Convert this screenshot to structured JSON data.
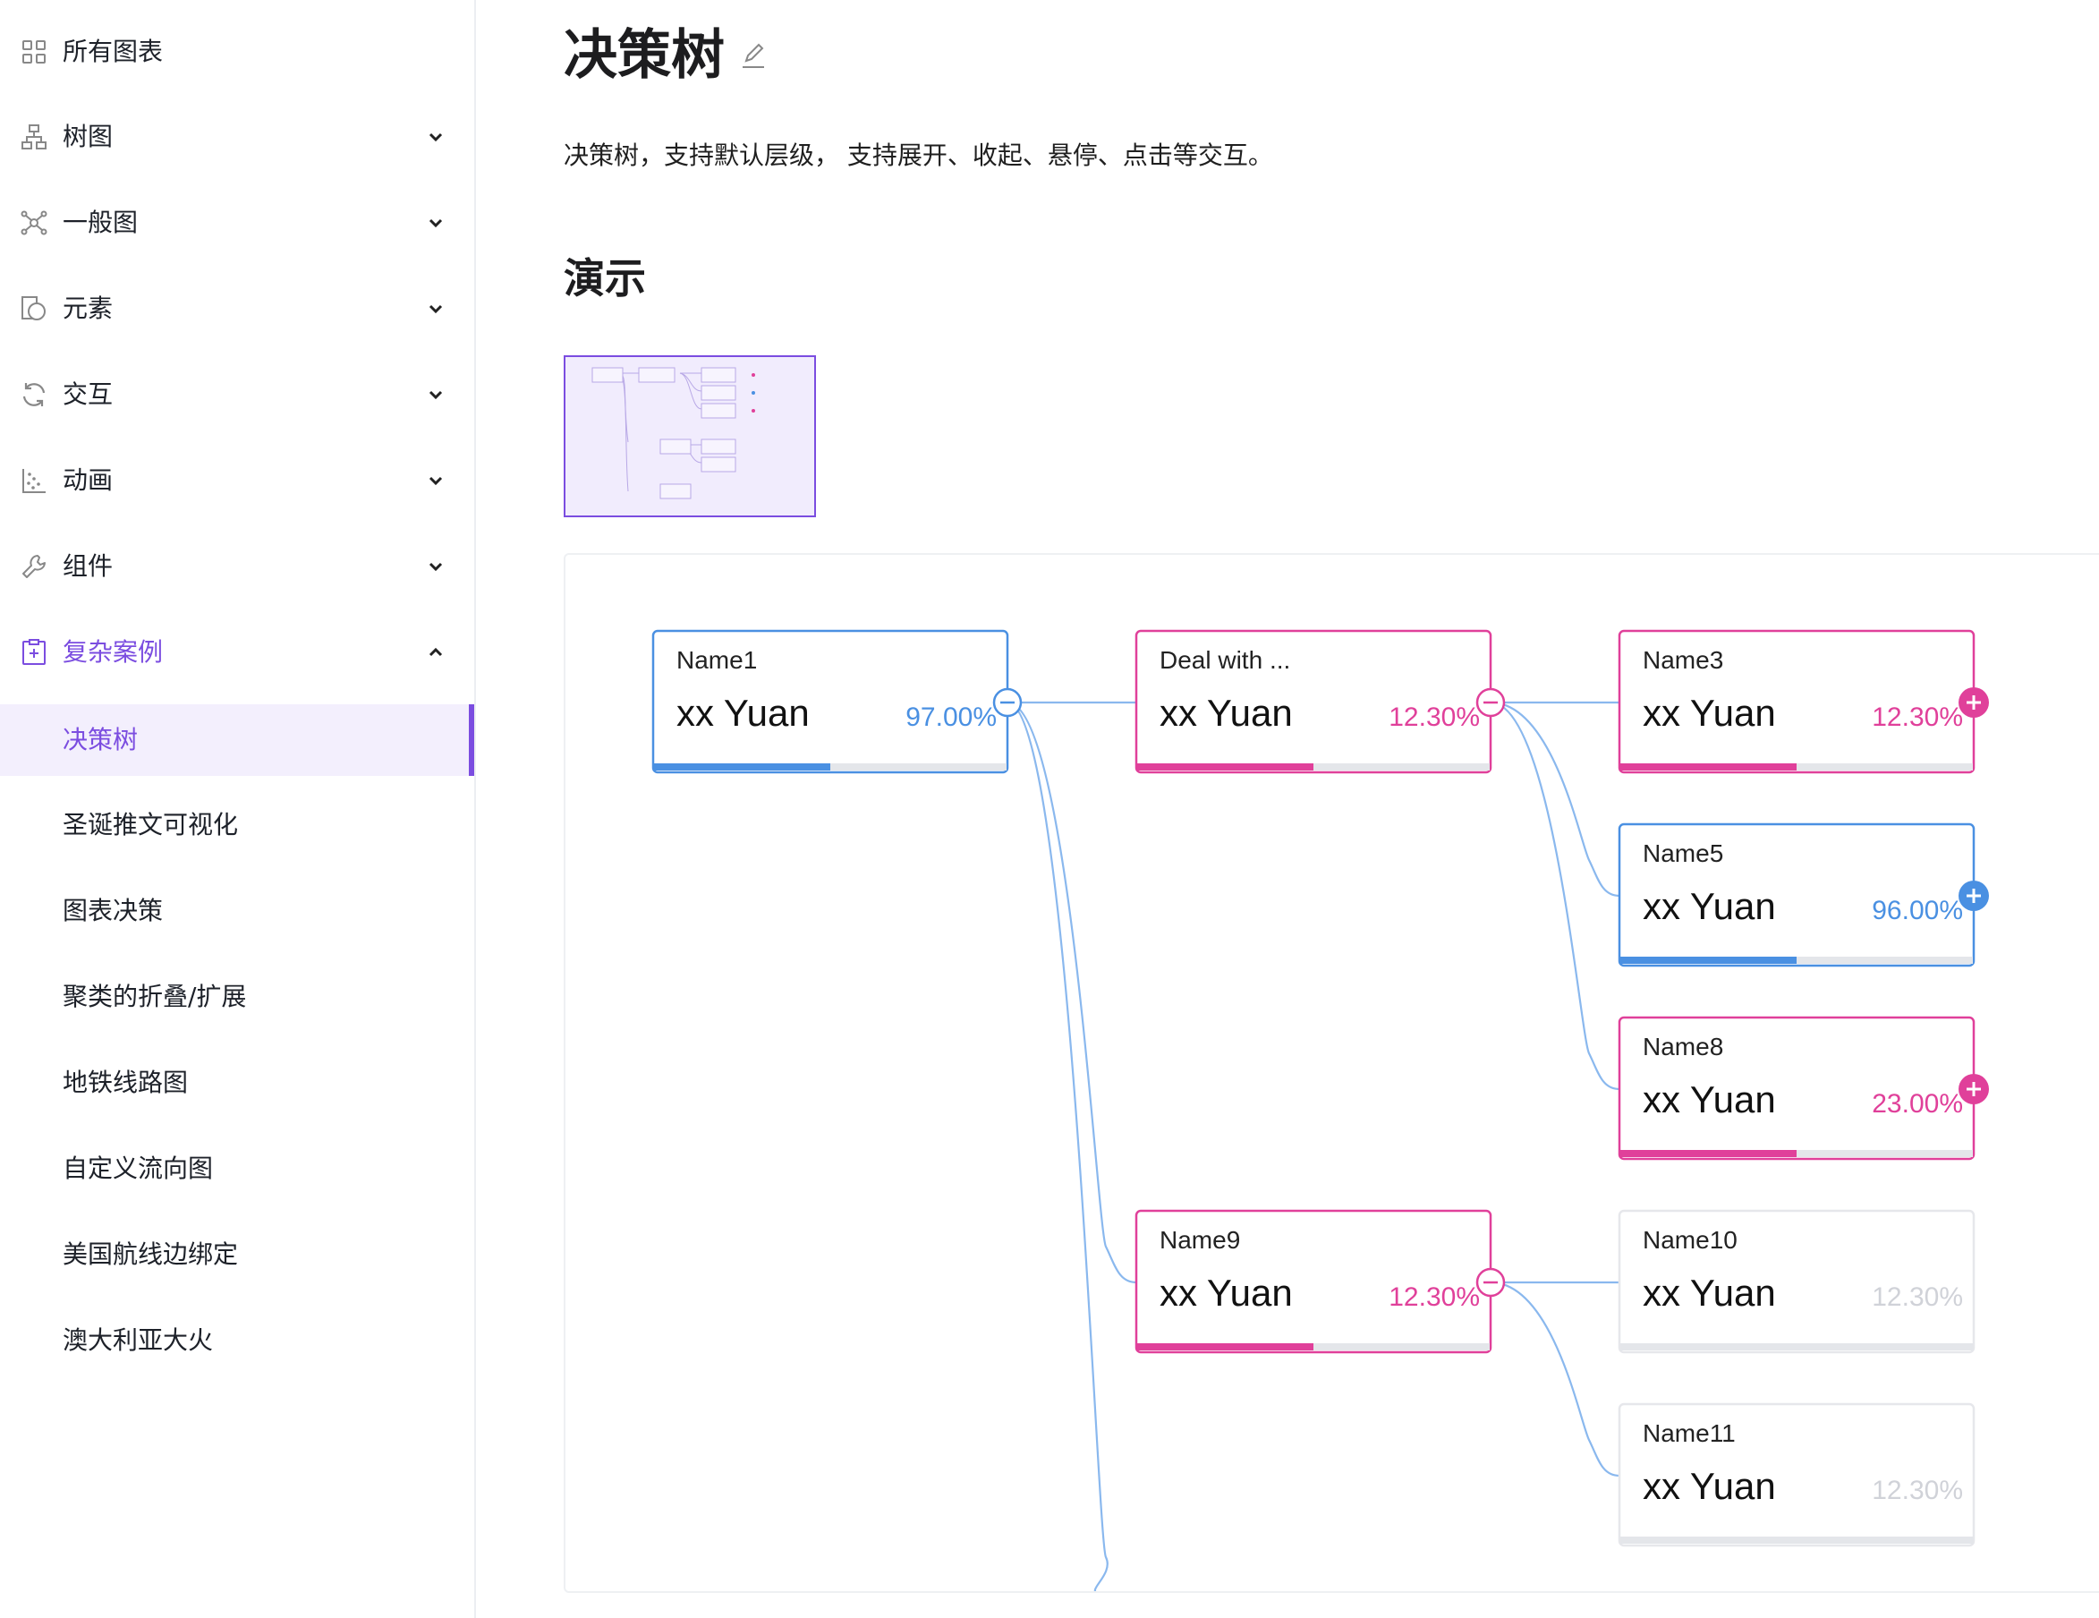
{
  "sidebar": {
    "items": [
      {
        "label": "所有图表",
        "icon": "grid-icon",
        "chevron": ""
      },
      {
        "label": "树图",
        "icon": "tree-icon",
        "chevron": "down"
      },
      {
        "label": "一般图",
        "icon": "graph-icon",
        "chevron": "down"
      },
      {
        "label": "元素",
        "icon": "shapes-icon",
        "chevron": "down"
      },
      {
        "label": "交互",
        "icon": "refresh-icon",
        "chevron": "down"
      },
      {
        "label": "动画",
        "icon": "scatter-icon",
        "chevron": "down"
      },
      {
        "label": "组件",
        "icon": "wrench-icon",
        "chevron": "down"
      },
      {
        "label": "复杂案例",
        "icon": "case-icon",
        "chevron": "up"
      }
    ],
    "sub_items": [
      {
        "label": "决策树",
        "active": true
      },
      {
        "label": "圣诞推文可视化"
      },
      {
        "label": "图表决策"
      },
      {
        "label": "聚类的折叠/扩展"
      },
      {
        "label": "地铁线路图"
      },
      {
        "label": "自定义流向图"
      },
      {
        "label": "美国航线边绑定"
      },
      {
        "label": "澳大利亚大火"
      }
    ]
  },
  "page": {
    "title": "决策树",
    "description": "决策树，支持默认层级， 支持展开、收起、悬停、点击等交互。",
    "demo_heading": "演示"
  },
  "colors": {
    "accent": "#7b4de0",
    "blue": "#4a90e2",
    "pink": "#e0409a",
    "muted": "#d9d9de",
    "edge": "#8ab8ee"
  },
  "tree": {
    "nodes": [
      {
        "id": "n1",
        "name": "Name1",
        "value": "xx Yuan",
        "rate": "97.00%",
        "rate_fraction": 0.5,
        "color": "blue",
        "toggle": "collapse"
      },
      {
        "id": "n2",
        "name": "Deal with ...",
        "value": "xx Yuan",
        "rate": "12.30%",
        "rate_fraction": 0.5,
        "color": "pink",
        "toggle": "collapse"
      },
      {
        "id": "n3",
        "name": "Name3",
        "value": "xx Yuan",
        "rate": "12.30%",
        "rate_fraction": 0.5,
        "color": "pink",
        "toggle": "expand"
      },
      {
        "id": "n5",
        "name": "Name5",
        "value": "xx Yuan",
        "rate": "96.00%",
        "rate_fraction": 0.5,
        "color": "blue",
        "toggle": "expand"
      },
      {
        "id": "n8",
        "name": "Name8",
        "value": "xx Yuan",
        "rate": "23.00%",
        "rate_fraction": 0.5,
        "color": "pink",
        "toggle": "expand"
      },
      {
        "id": "n9",
        "name": "Name9",
        "value": "xx Yuan",
        "rate": "12.30%",
        "rate_fraction": 0.5,
        "color": "pink",
        "toggle": "collapse"
      },
      {
        "id": "n10",
        "name": "Name10",
        "value": "xx Yuan",
        "rate": "12.30%",
        "rate_fraction": 0,
        "color": "muted",
        "toggle": ""
      },
      {
        "id": "n11",
        "name": "Name11",
        "value": "xx Yuan",
        "rate": "12.30%",
        "rate_fraction": 0,
        "color": "muted",
        "toggle": ""
      }
    ],
    "edges": [
      [
        "n1",
        "n2"
      ],
      [
        "n1",
        "n9"
      ],
      [
        "n1",
        "offscreen"
      ],
      [
        "n2",
        "n3"
      ],
      [
        "n2",
        "n5"
      ],
      [
        "n2",
        "n8"
      ],
      [
        "n9",
        "n10"
      ],
      [
        "n9",
        "n11"
      ]
    ]
  }
}
